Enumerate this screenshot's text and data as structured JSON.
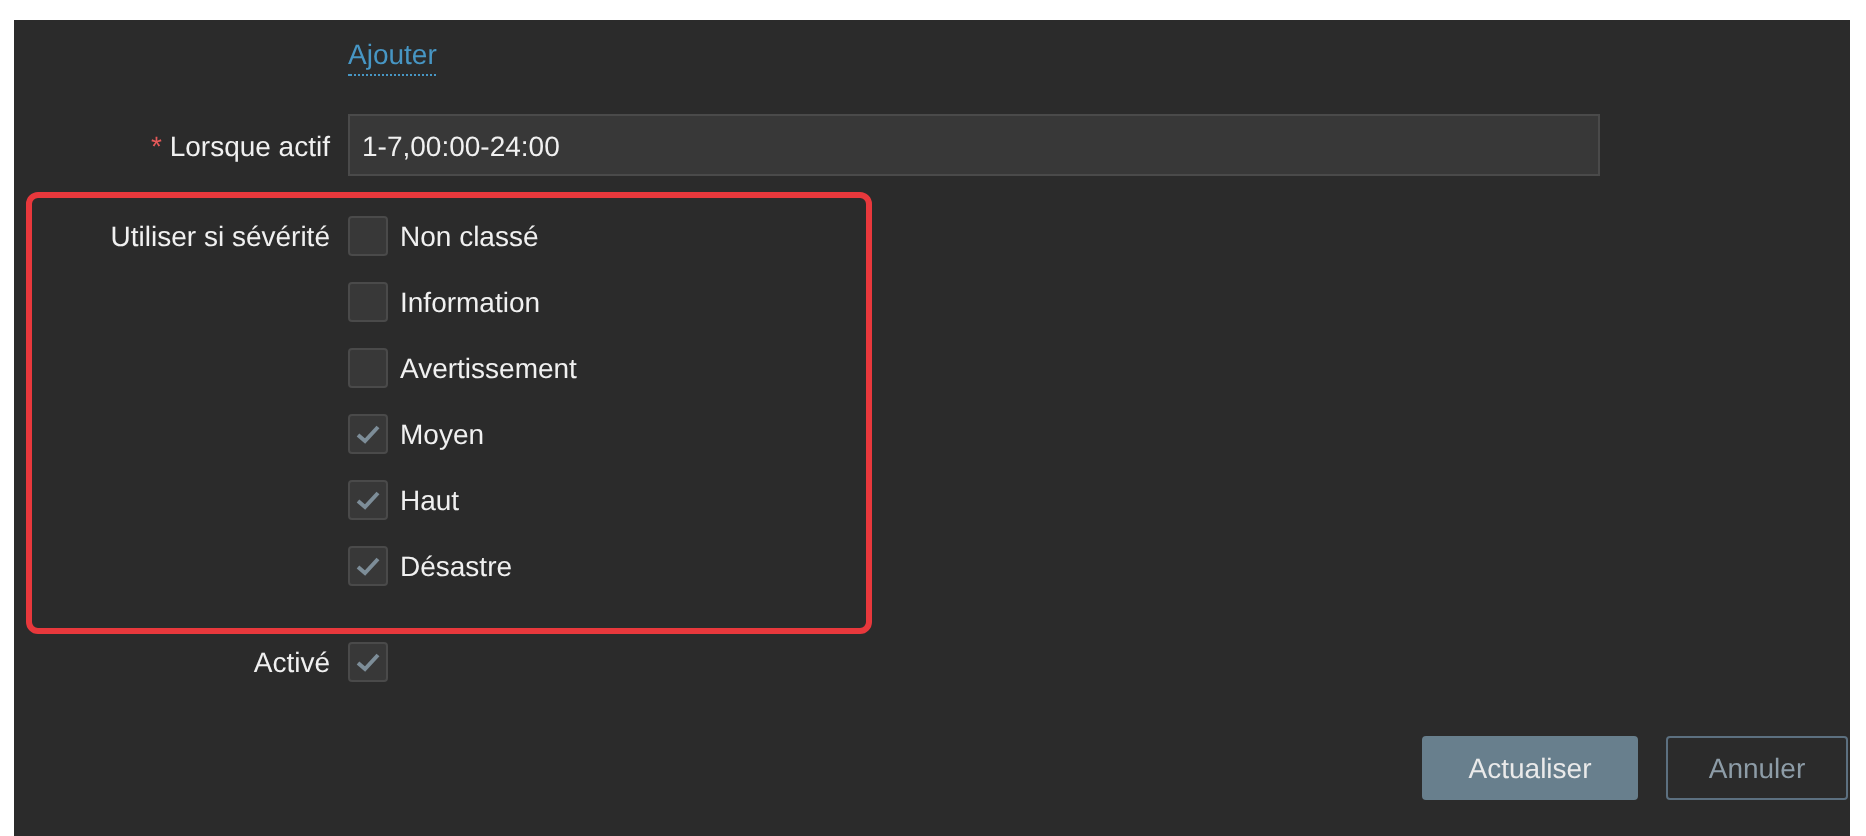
{
  "add_link": "Ajouter",
  "when_active": {
    "label": "Lorsque actif",
    "required_mark": "*",
    "value": "1-7,00:00-24:00"
  },
  "severity": {
    "label": "Utiliser si sévérité",
    "options": [
      {
        "label": "Non classé",
        "checked": false
      },
      {
        "label": "Information",
        "checked": false
      },
      {
        "label": "Avertissement",
        "checked": false
      },
      {
        "label": "Moyen",
        "checked": true
      },
      {
        "label": "Haut",
        "checked": true
      },
      {
        "label": "Désastre",
        "checked": true
      }
    ]
  },
  "enabled": {
    "label": "Activé",
    "checked": true
  },
  "buttons": [
    {
      "label": "Actualiser",
      "kind": "primary"
    },
    {
      "label": "Annuler",
      "kind": "secondary"
    }
  ]
}
